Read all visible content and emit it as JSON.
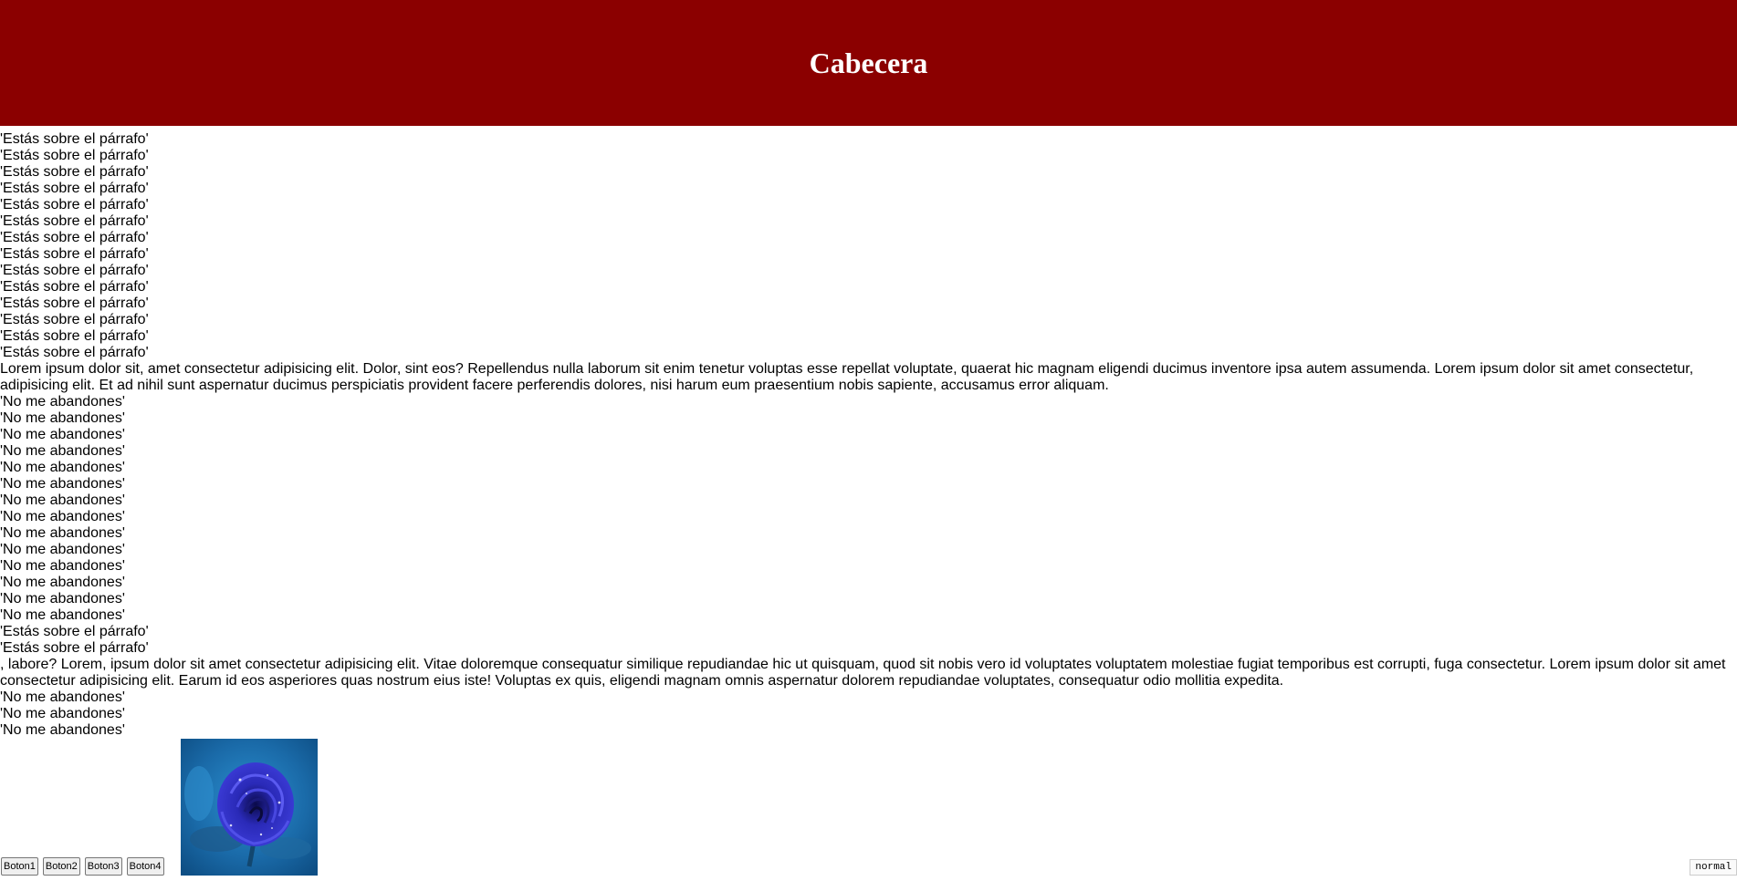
{
  "colors": {
    "header_bg": "#8b0000",
    "header_text": "#ffffff"
  },
  "header": {
    "title": "Cabecera"
  },
  "lines": [
    "'Estás sobre el párrafo'",
    "'Estás sobre el párrafo'",
    "'Estás sobre el párrafo'",
    "'Estás sobre el párrafo'",
    "'Estás sobre el párrafo'",
    "'Estás sobre el párrafo'",
    "'Estás sobre el párrafo'",
    "'Estás sobre el párrafo'",
    "'Estás sobre el párrafo'",
    "'Estás sobre el párrafo'",
    "'Estás sobre el párrafo'",
    "'Estás sobre el párrafo'",
    "'Estás sobre el párrafo'",
    "'Estás sobre el párrafo'",
    "Lorem ipsum dolor sit, amet consectetur adipisicing elit. Dolor, sint eos? Repellendus nulla laborum sit enim tenetur voluptas esse repellat voluptate, quaerat hic magnam eligendi ducimus inventore ipsa autem assumenda. Lorem ipsum dolor sit amet consectetur, adipisicing elit. Et ad nihil sunt aspernatur ducimus perspiciatis provident facere perferendis dolores, nisi harum eum praesentium nobis sapiente, accusamus error aliquam.",
    "'No me abandones'",
    "'No me abandones'",
    "'No me abandones'",
    "'No me abandones'",
    "'No me abandones'",
    "'No me abandones'",
    "'No me abandones'",
    "'No me abandones'",
    "'No me abandones'",
    "'No me abandones'",
    "'No me abandones'",
    "'No me abandones'",
    "'No me abandones'",
    "'No me abandones'",
    "'Estás sobre el párrafo'",
    "'Estás sobre el párrafo'",
    ", labore? Lorem, ipsum dolor sit amet consectetur adipisicing elit. Vitae doloremque consequatur similique repudiandae hic ut quisquam, quod sit nobis vero id voluptates voluptatem molestiae fugiat temporibus est corrupti, fuga consectetur. Lorem ipsum dolor sit amet consectetur adipisicing elit. Earum id eos asperiores quas nostrum eius iste! Voluptas ex quis, eligendi magnam omnis aspernatur dolorem repudiandae voluptates, consequatur odio mollitia expedita.",
    "'No me abandones'",
    "'No me abandones'",
    "'No me abandones'"
  ],
  "buttons": [
    "Boton1",
    "Boton2",
    "Boton3",
    "Boton4"
  ],
  "image": {
    "icon": "blue-rose-image"
  },
  "status": "normal"
}
